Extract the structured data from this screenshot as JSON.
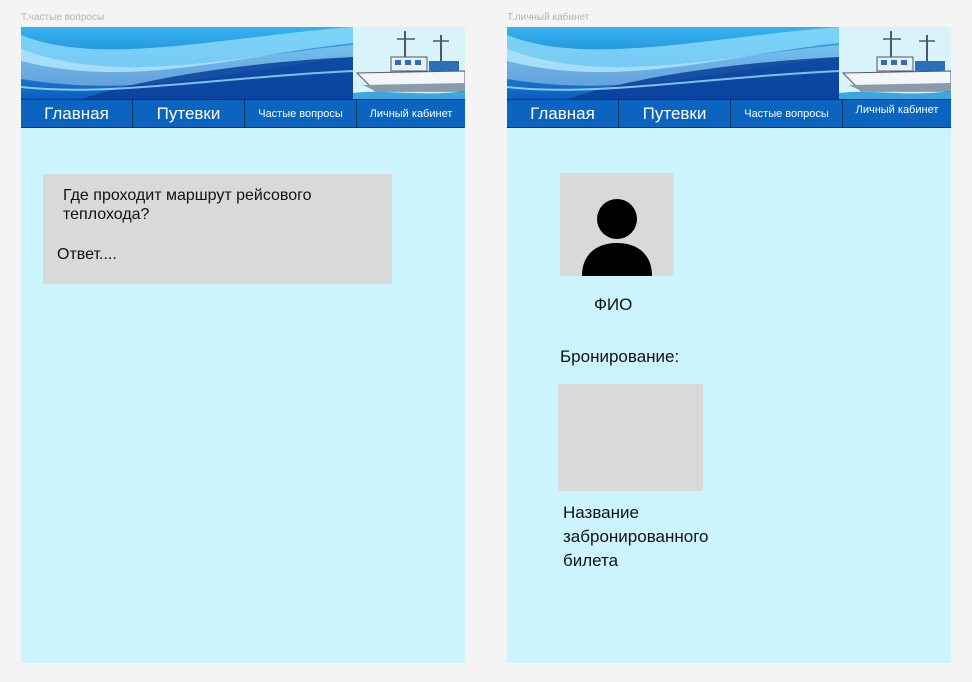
{
  "frames": {
    "faq": {
      "label": "Т.частые вопросы"
    },
    "profile": {
      "label": "Т.личный кабинет"
    }
  },
  "nav": {
    "home": "Главная",
    "tours": "Путевки",
    "faq": "Частые вопросы",
    "account": "Личный кабинет"
  },
  "faq_page": {
    "question": "Где проходит маршрут рейсового теплохода?",
    "answer": "Ответ...."
  },
  "profile_page": {
    "fio": "ФИО",
    "booking_label": "Бронирование:",
    "ticket_name": "Название забронированного билета"
  },
  "colors": {
    "page_bg": "#f4f4f4",
    "frame_bg": "#cbf4fd",
    "nav_bg": "#0a64c0",
    "placeholder_gray": "#d9d9d9"
  },
  "icons": {
    "avatar": "user-silhouette-icon",
    "banner_ship": "ship-illustration"
  }
}
